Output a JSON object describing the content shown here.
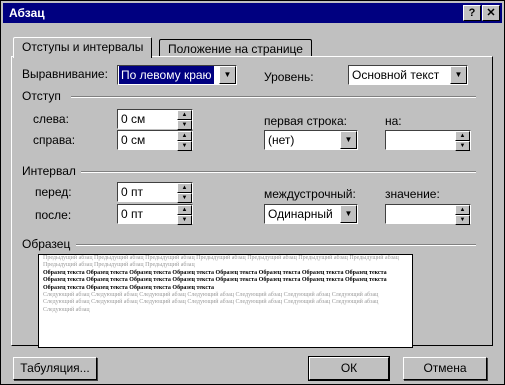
{
  "window": {
    "title": "Абзац",
    "help_glyph": "?",
    "close_glyph": "✕"
  },
  "tabs": [
    {
      "label": "Отступы и интервалы",
      "active": true
    },
    {
      "label": "Положение на странице",
      "active": false
    }
  ],
  "alignment": {
    "label": "Выравнивание:",
    "value": "По левому краю"
  },
  "level": {
    "label": "Уровень:",
    "value": "Основной текст"
  },
  "indent": {
    "group_label": "Отступ",
    "left": {
      "label": "слева:",
      "value": "0 см"
    },
    "right": {
      "label": "справа:",
      "value": "0 см"
    },
    "first_line": {
      "label": "первая строка:",
      "value": "(нет)"
    },
    "by": {
      "label": "на:",
      "value": ""
    }
  },
  "spacing": {
    "group_label": "Интервал",
    "before": {
      "label": "перед:",
      "value": "0 пт"
    },
    "after": {
      "label": "после:",
      "value": "0 пт"
    },
    "line": {
      "label": "междустрочный:",
      "value": "Одинарный"
    },
    "at": {
      "label": "значение:",
      "value": ""
    }
  },
  "sample": {
    "group_label": "Образец",
    "previous_text": "Предыдущий абзац Предыдущий абзац Предыдущий абзац Предыдущий абзац Предыдущий абзац Предыдущий абзац Предыдущий абзац Предыдущий абзац Предыдущий абзац Предыдущий абзац",
    "current_text": "Образец текста Образец текста Образец текста Образец текста Образец текста Образец текста Образец текста Образец текста Образец текста Образец текста Образец текста Образец текста Образец текста Образец текста Образец текста Образец текста Образец текста Образец текста Образец текста Образец текста",
    "next_text": "Следующий абзац Следующий абзац Следующий абзац Следующий абзац Следующий абзац Следующий абзац Следующий абзац Следующий абзац Следующий абзац Следующий абзац Следующий абзац Следующий абзац Следующий абзац Следующий абзац Следующий абзац"
  },
  "buttons": {
    "tabs": "Табуляция...",
    "ok": "ОК",
    "cancel": "Отмена"
  },
  "colors": {
    "titlebar": "#000080",
    "face": "#c0c0c0"
  }
}
